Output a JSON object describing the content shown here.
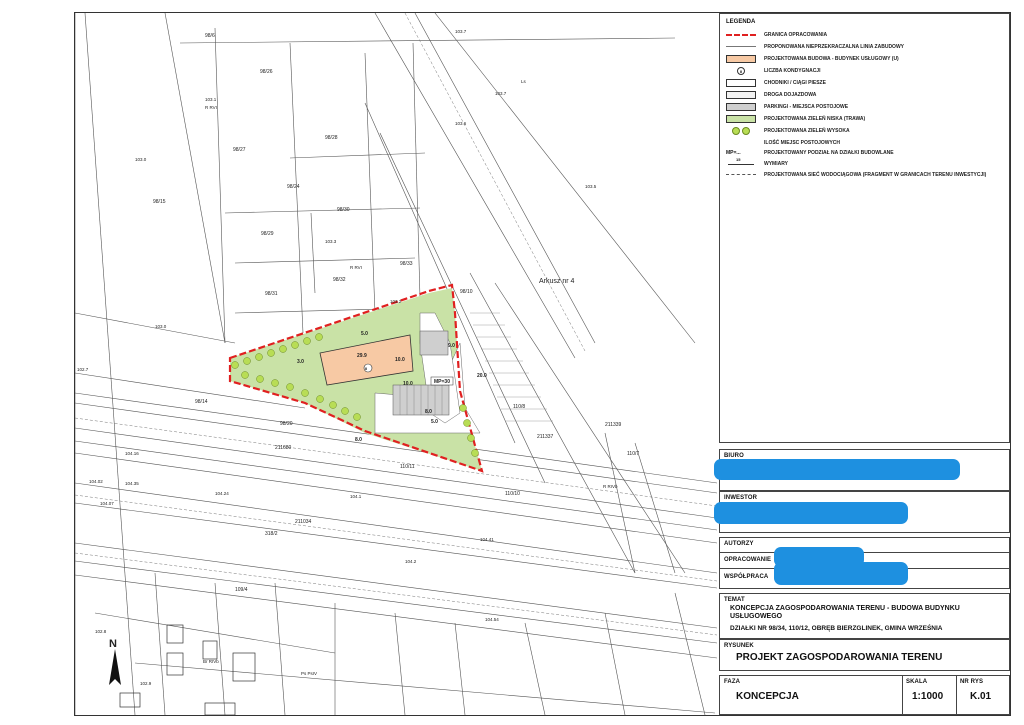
{
  "legend": {
    "title": "LEGENDA",
    "items": [
      {
        "id": "granica",
        "text": "GRANICA OPRACOWANIA"
      },
      {
        "id": "linia",
        "text": "PROPONOWANA NIEPRZEKRACZALNA LINIA ZABUDOWY"
      },
      {
        "id": "budynek",
        "text": "PROJEKTOWANA BUDOWA - BUDYNEK USŁUGOWY (U)"
      },
      {
        "id": "kondygnacje",
        "text": "LICZBA KONDYGNACJI"
      },
      {
        "id": "chodniki",
        "text": "CHODNIKI / CIĄGI PIESZE"
      },
      {
        "id": "droga",
        "text": "DROGA DOJAZDOWA"
      },
      {
        "id": "parkingi",
        "text": "PARKINGI - MIEJSCA POSTOJOWE"
      },
      {
        "id": "zielen_niska",
        "text": "PROJEKTOWANA ZIELEŃ NISKA (TRAWA)"
      },
      {
        "id": "zielen_wysoka",
        "text": "PROJEKTOWANA ZIELEŃ WYSOKA"
      },
      {
        "id": "miejsca",
        "text": "ILOŚĆ MIEJSC POSTOJOWYCH"
      },
      {
        "id": "podzial",
        "text": "PROJEKTOWANY PODZIAŁ NA DZIAŁKI BUDOWLANE"
      },
      {
        "id": "wymiary",
        "text": "WYMIARY"
      },
      {
        "id": "siec",
        "text": "PROJEKTOWANA SIEĆ WODOCIĄGOWA (FRAGMENT W GRANICACH TERENU INWESTYCJI)"
      }
    ],
    "sym_kondygnacje": "II",
    "sym_podzial": "MP=...",
    "sym_wymiary": "15"
  },
  "colors": {
    "granica": "#e02020",
    "budynek": "#f7c9a4",
    "zielen": "#c9e2a6",
    "parking": "#cfcfcf",
    "tree": "#b8dd55",
    "redact": "#1e90e0"
  },
  "biuro": {
    "label": "BIURO"
  },
  "inwestor": {
    "label": "INWESTOR"
  },
  "autorzy": {
    "label": "AUTORZY",
    "opracowanie": "OPRACOWANIE",
    "wspolpraca": "WSPÓŁPRACA"
  },
  "temat": {
    "label": "TEMAT",
    "line1": "KONCEPCJA ZAGOSPODAROWANIA TERENU - BUDOWA BUDYNKU",
    "line2": "USŁUGOWEGO",
    "line3": "DZIAŁKI NR 98/34, 110/12, OBRĘB BIERZGLINEK, GMINA WRZEŚNIA"
  },
  "rysunek": {
    "label": "RYSUNEK",
    "title": "PROJEKT ZAGOSPODAROWANIA TERENU"
  },
  "faza": {
    "label": "FAZA",
    "value": "KONCEPCJA"
  },
  "skala": {
    "label": "SKALA",
    "value": "1:1000"
  },
  "nrrys": {
    "label": "NR RYS",
    "value": "K.01"
  },
  "map": {
    "arkusz": "Arkusz nr 4",
    "north": "N",
    "parcels": [
      "98/6",
      "98/26",
      "98/27",
      "98/28",
      "98/24",
      "98/30",
      "98/15",
      "98/29",
      "98/32",
      "98/33",
      "98/31",
      "98/10",
      "98/14",
      "98/20",
      "110/11",
      "110/8",
      "211337",
      "211339",
      "211034",
      "318/2",
      "109/4",
      "110/10",
      "211680",
      "110/7"
    ],
    "heights": [
      "103.7",
      "103.7",
      "103.6",
      "103.1",
      "103.0",
      "103.3",
      "103.2",
      "102.7",
      "103.0",
      "103.5",
      "104.35",
      "104.16",
      "104.07",
      "104.24",
      "104.02",
      "104.1",
      "104.41",
      "104.2",
      "104.54",
      "102.8",
      "102.9"
    ],
    "soils": [
      "R RVI",
      "R RVI",
      "R RIVb",
      "Ls",
      "Br RIVb",
      "Ps PsIV"
    ],
    "dims": [
      "29.9",
      "10.0",
      "9.0",
      "5.0",
      "10.0",
      "20.0",
      "8.0",
      "5.0",
      "8.0",
      "3.0"
    ],
    "mp": "MP=30",
    "storeys": "II"
  }
}
